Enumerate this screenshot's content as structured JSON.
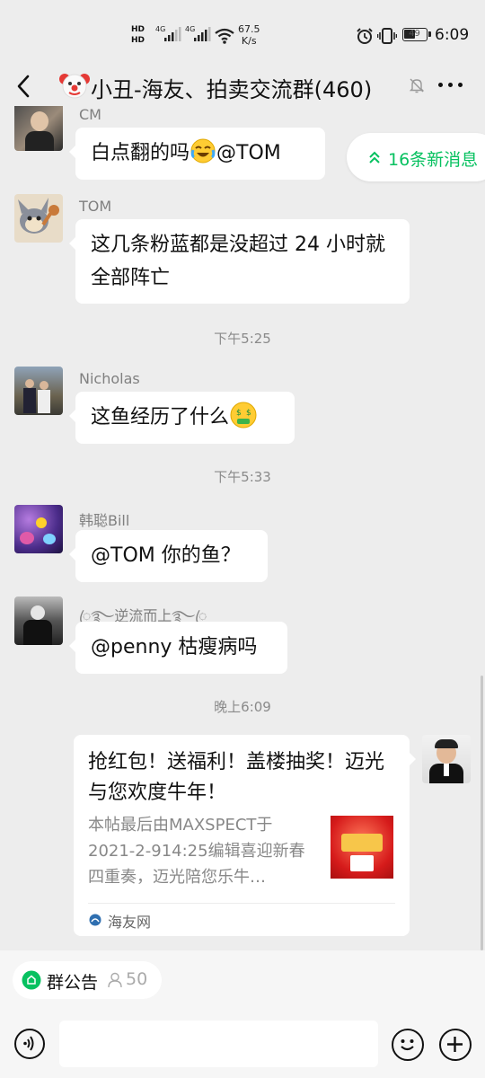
{
  "status_bar": {
    "hd1": "HD",
    "hd2": "HD",
    "net1": "4G",
    "net2": "4G",
    "speed_value": "67.5",
    "speed_unit": "K/s",
    "battery": "49",
    "time": "6:09"
  },
  "header": {
    "back_icon": "chevron-left-icon",
    "group_emoji_icon": "clown-face-icon",
    "title": "小丑-海友、拍卖交流群(460)",
    "mute_icon": "bell-off-icon",
    "more_icon": "more-dots-icon"
  },
  "new_messages": {
    "label": "16条新消息",
    "icon": "double-chevron-up-icon",
    "accent": "#07c160"
  },
  "messages": [
    {
      "sender": "CM",
      "text_before": "白点翻的吗",
      "emoji": "crying-laughing-icon",
      "text_after": "@TOM"
    },
    {
      "sender": "TOM",
      "text": "这几条粉蓝都是没超过 24 小时就全部阵亡"
    },
    {
      "time": "下午5:25"
    },
    {
      "sender": "Nicholas",
      "text": "这鱼经历了什么",
      "emoji": "money-mouth-icon"
    },
    {
      "time": "下午5:33"
    },
    {
      "sender": "韩聪Bill",
      "text": "@TOM  你的鱼？"
    },
    {
      "sender": "ꦿ࿐逆流而上࿐ꦿ",
      "text": "@penny  枯瘦病吗"
    },
    {
      "time": "晚上6:09"
    }
  ],
  "link_card": {
    "title": "抢红包！送福利！盖楼抽奖！迈光与您欢度牛年！",
    "description": "本帖最后由MAXSPECT于2021-2-914:25编辑喜迎新春四重奏，迈光陪您乐牛…",
    "source_name": "海友网",
    "source_icon": "haiyou-logo-icon"
  },
  "announcement": {
    "label": "群公告",
    "member_count": "50",
    "icon": "announcement-icon",
    "person_icon": "person-icon"
  },
  "input_bar": {
    "voice_icon": "voice-icon",
    "emoji_icon": "smile-icon",
    "plus_icon": "plus-icon"
  }
}
